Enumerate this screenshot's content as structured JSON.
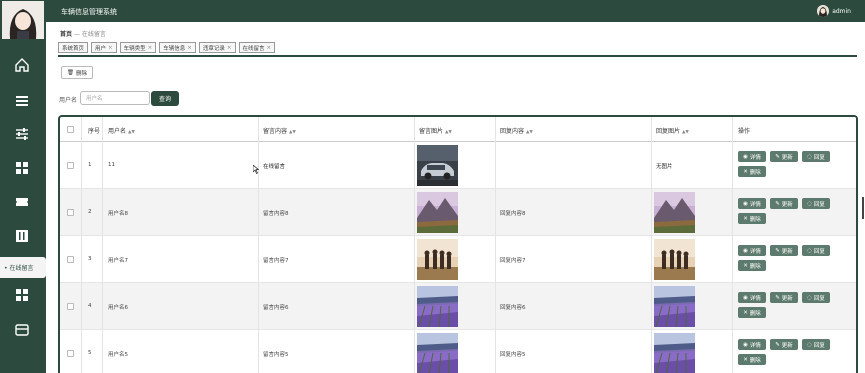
{
  "header": {
    "app_title": "车辆信息管理系统",
    "user_name": "admin"
  },
  "sidebar": {
    "active_label": "在线留言",
    "icons": [
      "home-icon",
      "list-icon",
      "sliders-icon",
      "grid-icon",
      "ticket-icon",
      "book-icon",
      "grid-icon",
      "card-icon"
    ]
  },
  "breadcrumb": {
    "home": "首页",
    "separator": "—",
    "current": "在线留言"
  },
  "tabs": [
    {
      "label": "系统首页",
      "closable": false
    },
    {
      "label": "用户",
      "closable": true
    },
    {
      "label": "车辆类型",
      "closable": true
    },
    {
      "label": "车辆信息",
      "closable": true
    },
    {
      "label": "违章记录",
      "closable": true
    },
    {
      "label": "在线留言",
      "closable": true
    }
  ],
  "toolbar": {
    "delete_label": "删除"
  },
  "search": {
    "label": "用户名",
    "placeholder": "用户名",
    "button_label": "查询"
  },
  "table": {
    "columns": {
      "index": "序号",
      "username": "用户名",
      "content": "留言内容",
      "image": "留言图片",
      "reply": "回复内容",
      "reply_image": "回复图片",
      "actions": "操作"
    },
    "action_labels": {
      "detail": "详情",
      "update": "更新",
      "reply": "回复",
      "delete": "删除"
    },
    "rows": [
      {
        "index": "1",
        "username": "11",
        "content": "在线留言",
        "image": "car",
        "reply": "",
        "reply_image_text": "无图片",
        "reply_image": ""
      },
      {
        "index": "2",
        "username": "用户名8",
        "content": "留言内容8",
        "image": "mountain",
        "reply": "回复内容8",
        "reply_image_text": "",
        "reply_image": "mountain"
      },
      {
        "index": "3",
        "username": "用户名7",
        "content": "留言内容7",
        "image": "people",
        "reply": "回复内容7",
        "reply_image_text": "",
        "reply_image": "people"
      },
      {
        "index": "4",
        "username": "用户名6",
        "content": "留言内容6",
        "image": "lavender",
        "reply": "回复内容6",
        "reply_image_text": "",
        "reply_image": "lavender"
      },
      {
        "index": "5",
        "username": "用户名5",
        "content": "留言内容5",
        "image": "lavender",
        "reply": "回复内容5",
        "reply_image_text": "",
        "reply_image": "lavender"
      }
    ]
  },
  "colors": {
    "primary": "#2c4a3e",
    "button": "#5d7a6e"
  }
}
